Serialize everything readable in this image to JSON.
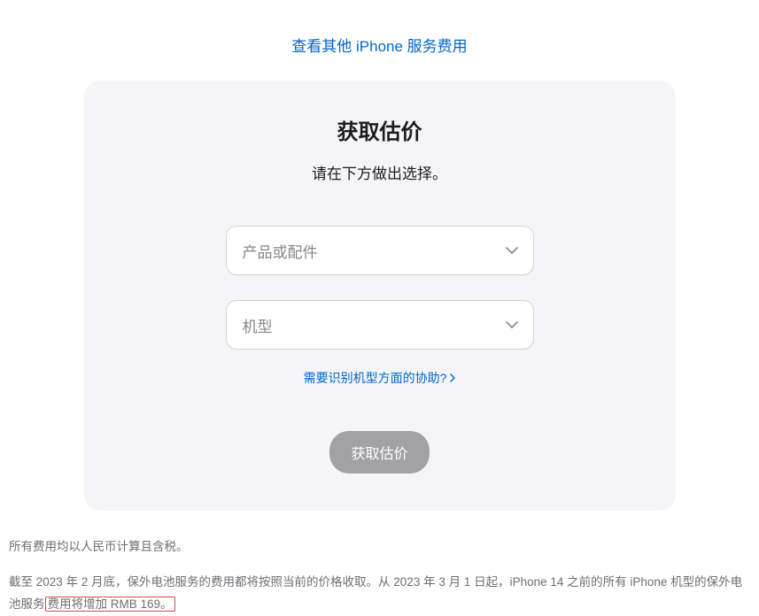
{
  "topLink": {
    "label": "查看其他 iPhone 服务费用"
  },
  "card": {
    "title": "获取估价",
    "subtitle": "请在下方做出选择。",
    "select1": {
      "placeholder": "产品或配件"
    },
    "select2": {
      "placeholder": "机型"
    },
    "helpLink": {
      "label": "需要识别机型方面的协助?"
    },
    "button": {
      "label": "获取估价"
    }
  },
  "footnotes": {
    "note1": "所有费用均以人民币计算且含税。",
    "note2_prefix": "截至 2023 年 2 月底，保外电池服务的费用都将按照当前的价格收取。从 2023 年 3 月 1 日起，iPhone 14 之前的所有 iPhone 机型的保外电池服务",
    "note2_highlight": "费用将增加 RMB 169。"
  }
}
